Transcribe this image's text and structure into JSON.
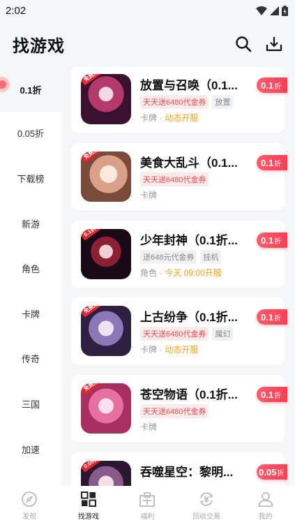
{
  "status_bar": {
    "time": "2:02"
  },
  "header": {
    "title": "找游戏"
  },
  "sidebar": {
    "items": [
      {
        "label": "0.1折"
      },
      {
        "label": "0.05折"
      },
      {
        "label": "下载榜"
      },
      {
        "label": "新游"
      },
      {
        "label": "角色"
      },
      {
        "label": "卡牌"
      },
      {
        "label": "传奇"
      },
      {
        "label": "三国"
      },
      {
        "label": "加速"
      }
    ]
  },
  "games": [
    {
      "title": "放置与召唤（0.1...",
      "tags": [
        "天天送6480代金券",
        "放置"
      ],
      "category": "卡牌 ·",
      "status": "动态开服",
      "discount": "0.1",
      "zhe": "折",
      "badge": "免费版",
      "thumb_color": "#c23a6a"
    },
    {
      "title": "美食大乱斗（0.1...",
      "tags": [
        "天天送6480代金券"
      ],
      "category": "卡牌",
      "status": "",
      "discount": "0.1",
      "zhe": "折",
      "badge": "免费版",
      "thumb_color": "#d9a08a"
    },
    {
      "title": "少年封神（0.1折...",
      "tags": [
        "送648元代金券",
        "挂机"
      ],
      "category": "角色 ·",
      "status": "今天 09:00开服",
      "discount": "0.1",
      "zhe": "折",
      "badge": "0.1折",
      "thumb_color": "#3a1f3a"
    },
    {
      "title": "上古纷争（0.1折...",
      "tags": [
        "天天送6480代金券",
        "魔幻"
      ],
      "category": "卡牌 ·",
      "status": "动态开服",
      "discount": "0.1",
      "zhe": "折",
      "badge": "免费版",
      "thumb_color": "#7a6aa8"
    },
    {
      "title": "苍空物语（0.1折...",
      "tags": [
        "天天送6480代金券"
      ],
      "category": "卡牌",
      "status": "",
      "discount": "0.1",
      "zhe": "折",
      "badge": "免费版",
      "thumb_color": "#e870a0"
    },
    {
      "title": "吞噬星空：黎明...",
      "tags": [],
      "category": "",
      "status": "",
      "discount": "0.05",
      "zhe": "折",
      "badge": "0.05折",
      "thumb_color": "#6a4a7a"
    }
  ],
  "bottom_nav": [
    {
      "label": "发现",
      "icon": "compass-icon"
    },
    {
      "label": "找游戏",
      "icon": "grid-icon"
    },
    {
      "label": "福利",
      "icon": "gift-icon"
    },
    {
      "label": "回收交易",
      "icon": "recycle-icon"
    },
    {
      "label": "我的",
      "icon": "user-icon"
    }
  ],
  "colors": {
    "accent": "#ff3e52",
    "tag_red": "#f04848",
    "status_orange": "#f5a21b"
  }
}
